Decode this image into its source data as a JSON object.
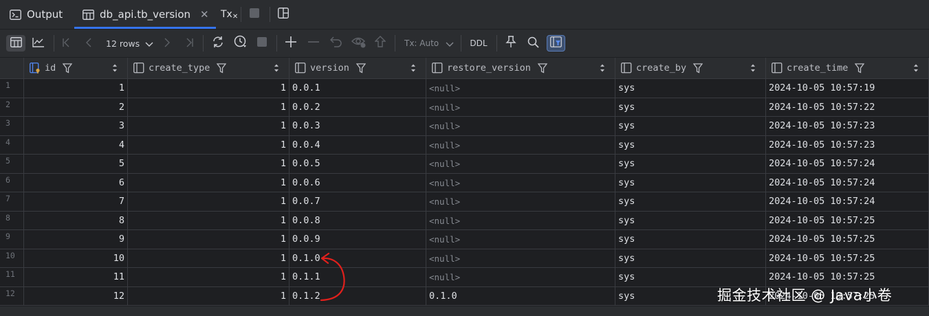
{
  "tabs": [
    {
      "label": "Output",
      "icon": "console-icon",
      "active": false
    },
    {
      "label": "db_api.tb_version",
      "icon": "table-icon",
      "active": true
    }
  ],
  "tab_actions": {
    "tx_label": "Tx"
  },
  "toolbar": {
    "rows_label": "12 rows",
    "tx_mode": "Tx: Auto",
    "ddl_label": "DDL"
  },
  "columns": [
    {
      "name": "id",
      "type": "key"
    },
    {
      "name": "create_type",
      "type": "column"
    },
    {
      "name": "version",
      "type": "column"
    },
    {
      "name": "restore_version",
      "type": "column"
    },
    {
      "name": "create_by",
      "type": "column"
    },
    {
      "name": "create_time",
      "type": "column"
    }
  ],
  "rows": [
    {
      "n": "1",
      "id": "1",
      "create_type": "1",
      "version": "0.0.1",
      "restore_version": "<null>",
      "create_by": "sys",
      "create_time": "2024-10-05 10:57:19"
    },
    {
      "n": "2",
      "id": "2",
      "create_type": "1",
      "version": "0.0.2",
      "restore_version": "<null>",
      "create_by": "sys",
      "create_time": "2024-10-05 10:57:22"
    },
    {
      "n": "3",
      "id": "3",
      "create_type": "1",
      "version": "0.0.3",
      "restore_version": "<null>",
      "create_by": "sys",
      "create_time": "2024-10-05 10:57:23"
    },
    {
      "n": "4",
      "id": "4",
      "create_type": "1",
      "version": "0.0.4",
      "restore_version": "<null>",
      "create_by": "sys",
      "create_time": "2024-10-05 10:57:23"
    },
    {
      "n": "5",
      "id": "5",
      "create_type": "1",
      "version": "0.0.5",
      "restore_version": "<null>",
      "create_by": "sys",
      "create_time": "2024-10-05 10:57:24"
    },
    {
      "n": "6",
      "id": "6",
      "create_type": "1",
      "version": "0.0.6",
      "restore_version": "<null>",
      "create_by": "sys",
      "create_time": "2024-10-05 10:57:24"
    },
    {
      "n": "7",
      "id": "7",
      "create_type": "1",
      "version": "0.0.7",
      "restore_version": "<null>",
      "create_by": "sys",
      "create_time": "2024-10-05 10:57:24"
    },
    {
      "n": "8",
      "id": "8",
      "create_type": "1",
      "version": "0.0.8",
      "restore_version": "<null>",
      "create_by": "sys",
      "create_time": "2024-10-05 10:57:25"
    },
    {
      "n": "9",
      "id": "9",
      "create_type": "1",
      "version": "0.0.9",
      "restore_version": "<null>",
      "create_by": "sys",
      "create_time": "2024-10-05 10:57:25"
    },
    {
      "n": "10",
      "id": "10",
      "create_type": "1",
      "version": "0.1.0",
      "restore_version": "<null>",
      "create_by": "sys",
      "create_time": "2024-10-05 10:57:25"
    },
    {
      "n": "11",
      "id": "11",
      "create_type": "1",
      "version": "0.1.1",
      "restore_version": "<null>",
      "create_by": "sys",
      "create_time": "2024-10-05 10:57:25"
    },
    {
      "n": "12",
      "id": "12",
      "create_type": "1",
      "version": "0.1.2",
      "restore_version": "0.1.0",
      "create_by": "sys",
      "create_time": "2024-10-05 10:57:25"
    }
  ],
  "watermark": "掘金技术社区 @ Java小卷",
  "colors": {
    "accent": "#3574f0",
    "annotation": "#e0201c",
    "background": "#1e1f22",
    "panel": "#2b2d30"
  }
}
